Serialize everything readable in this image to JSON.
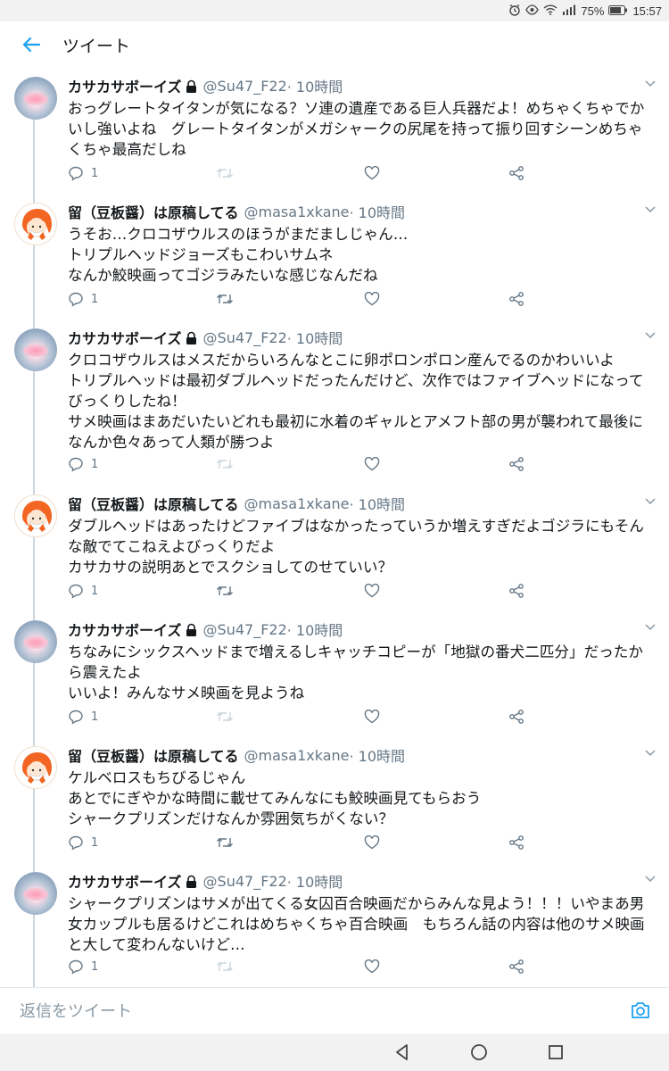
{
  "status_bar": {
    "battery": "75%",
    "time": "15:57",
    "icons": [
      "alarm-icon",
      "eye-icon",
      "wifi-icon",
      "signal-icon",
      "battery-icon"
    ]
  },
  "header": {
    "title": "ツイート",
    "back_icon": "arrow-left-icon",
    "accent_color": "#1da1f2"
  },
  "tweets": [
    {
      "name": "カサカサボーイズ",
      "handle": "@Su47_F22",
      "time": "· 10時間",
      "locked": true,
      "text": "おっグレートタイタンが気になる？ソ連の遺産である巨人兵器だよ！めちゃくちゃでかいし強いよね　グレートタイタンがメガシャークの尻尾を持って振り回すシーンめちゃくちゃ最高だしね",
      "reply_count": "1"
    },
    {
      "name": "留（豆板醤）は原稿してる",
      "handle": "@masa1xkane",
      "time": "· 10時間",
      "locked": false,
      "text": "うそお…クロコザウルスのほうがまだましじゃん…\nトリプルヘッドジョーズもこわいサムネ\nなんか鮫映画ってゴジラみたいな感じなんだね",
      "reply_count": "1"
    },
    {
      "name": "カサカサボーイズ",
      "handle": "@Su47_F22",
      "time": "· 10時間",
      "locked": true,
      "text": "クロコザウルスはメスだからいろんなとこに卵ポロンポロン産んでるのかわいいよ\nトリプルヘッドは最初ダブルヘッドだったんだけど、次作ではファイブヘッドになってびっくりしたね！\nサメ映画はまあだいたいどれも最初に水着のギャルとアメフト部の男が襲われて最後になんか色々あって人類が勝つよ",
      "reply_count": "1"
    },
    {
      "name": "留（豆板醤）は原稿してる",
      "handle": "@masa1xkane",
      "time": "· 10時間",
      "locked": false,
      "text": "ダブルヘッドはあったけどファイブはなかったっていうか増えすぎだよゴジラにもそんな敵でてこねえよびっくりだよ\nカサカサの説明あとでスクショしてのせていい？",
      "reply_count": "1"
    },
    {
      "name": "カサカサボーイズ",
      "handle": "@Su47_F22",
      "time": "· 10時間",
      "locked": true,
      "text": "ちなみにシックスヘッドまで増えるしキャッチコピーが「地獄の番犬二匹分」だったから震えたよ\nいいよ！みんなサメ映画を見ようね",
      "reply_count": "1"
    },
    {
      "name": "留（豆板醤）は原稿してる",
      "handle": "@masa1xkane",
      "time": "· 10時間",
      "locked": false,
      "text": "ケルベロスもちびるじゃん\nあとでにぎやかな時間に載せてみんなにも鮫映画見てもらおう\nシャークプリズンだけなんか雰囲気ちがくない？",
      "reply_count": "1"
    },
    {
      "name": "カサカサボーイズ",
      "handle": "@Su47_F22",
      "time": "· 10時間",
      "locked": true,
      "text": "シャークプリズンはサメが出てくる女囚百合映画だからみんな見よう！！！いやまあ男女カップルも居るけどこれはめちゃくちゃ百合映画　もちろん話の内容は他のサメ映画と大して変わんないけど…",
      "reply_count": "1"
    }
  ],
  "reply_bar": {
    "placeholder": "返信をツイート",
    "camera_icon": "camera-icon"
  },
  "nav_bar": {
    "icons": [
      "back-triangle-icon",
      "home-circle-icon",
      "recents-square-icon"
    ]
  }
}
